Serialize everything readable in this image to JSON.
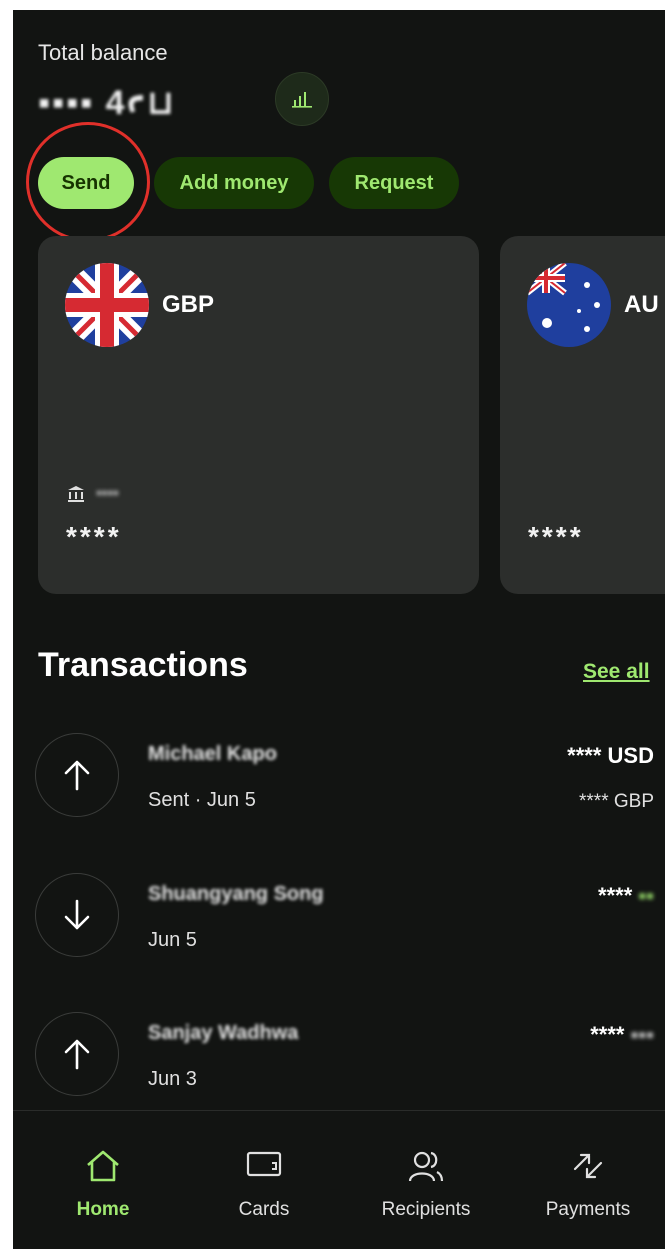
{
  "balance": {
    "label": "Total balance",
    "value": "▪▪▪▪ 4ꜥ⊔"
  },
  "actions": {
    "send": "Send",
    "add_money": "Add money",
    "request": "Request"
  },
  "accounts": [
    {
      "currency": "GBP",
      "bank_detail": "▪▪▪▪",
      "masked_number": "****"
    },
    {
      "currency": "AU",
      "masked_number": "****"
    }
  ],
  "transactions": {
    "title": "Transactions",
    "see_all": "See all",
    "items": [
      {
        "direction": "up-arrow",
        "name": "Michael Kapo",
        "sub": "Sent · Jun 5",
        "amount_mask": "****",
        "amount_currency": "USD",
        "secondary": "**** GBP"
      },
      {
        "direction": "down-arrow",
        "name": "Shuangyang Song",
        "sub": "Jun 5",
        "amount_mask": "****",
        "amount_currency": "▪▪"
      },
      {
        "direction": "up-arrow",
        "name": "Sanjay Wadhwa",
        "sub": "Jun 3",
        "amount_mask": "****",
        "amount_currency": "▪▪▪"
      }
    ]
  },
  "nav": {
    "items": [
      {
        "label": "Home",
        "icon": "home-icon",
        "active": true
      },
      {
        "label": "Cards",
        "icon": "card-icon"
      },
      {
        "label": "Recipients",
        "icon": "recipients-icon"
      },
      {
        "label": "Payments",
        "icon": "payments-icon"
      }
    ]
  },
  "colors": {
    "background": "#121412",
    "accent": "#9fe870",
    "accent_dark": "#173805",
    "card": "#2c2e2c",
    "highlight": "#e0302a"
  }
}
